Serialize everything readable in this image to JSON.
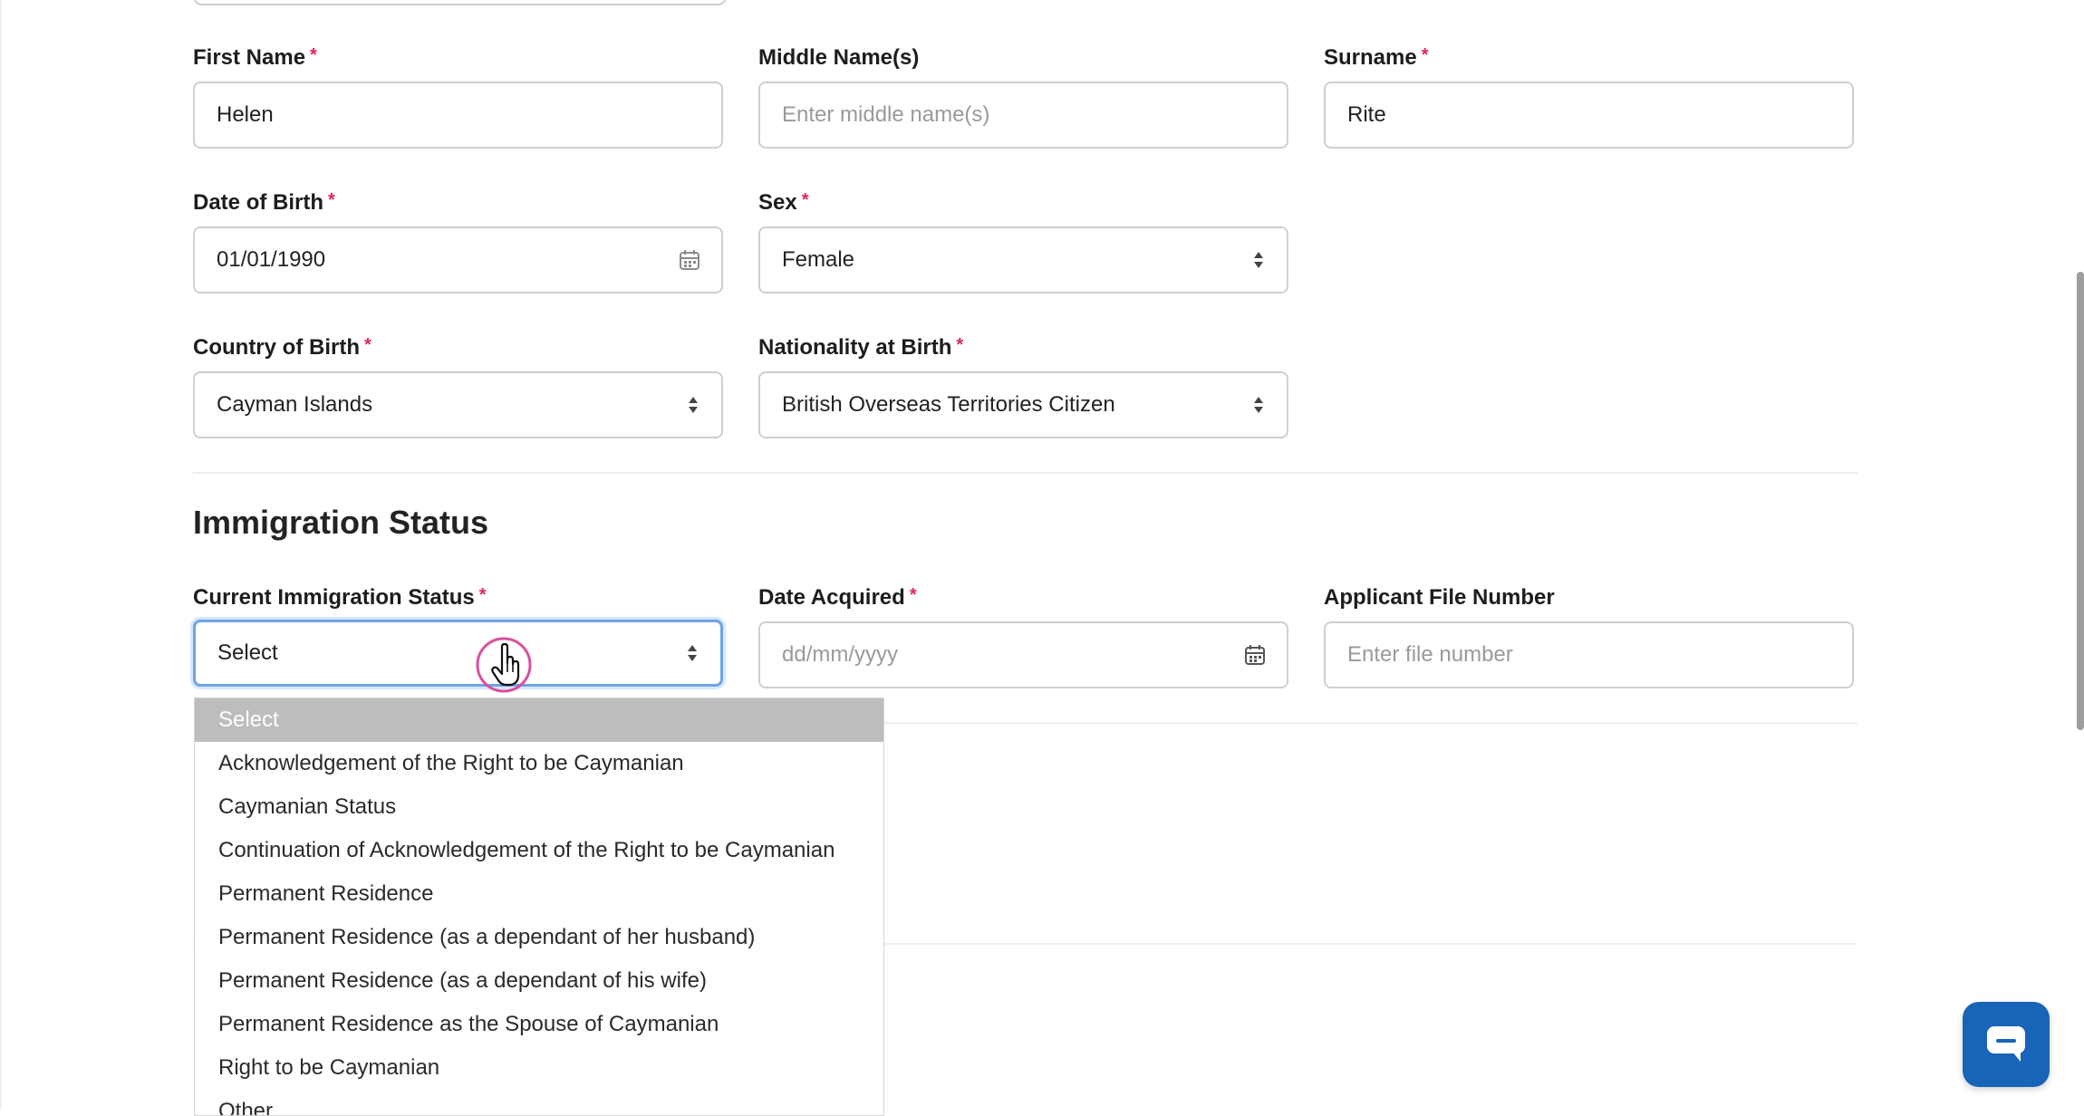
{
  "personal": {
    "first_name": {
      "label": "First Name",
      "value": "Helen",
      "required": "*"
    },
    "middle_name": {
      "label": "Middle Name(s)",
      "placeholder": "Enter middle name(s)"
    },
    "surname": {
      "label": "Surname",
      "value": "Rite",
      "required": "*"
    },
    "dob": {
      "label": "Date of Birth",
      "value": "01/01/1990",
      "required": "*"
    },
    "sex": {
      "label": "Sex",
      "value": "Female",
      "required": "*"
    },
    "country_of_birth": {
      "label": "Country of Birth",
      "value": "Cayman Islands",
      "required": "*"
    },
    "nationality_at_birth": {
      "label": "Nationality at Birth",
      "value": "British Overseas Territories Citizen",
      "required": "*"
    }
  },
  "immigration": {
    "title": "Immigration Status",
    "current_status": {
      "label": "Current Immigration Status",
      "value": "Select",
      "required": "*",
      "options": [
        "Select",
        "Acknowledgement of the Right to be Caymanian",
        "Caymanian Status",
        "Continuation of Acknowledgement of the Right to be Caymanian",
        "Permanent Residence",
        "Permanent Residence (as a dependant of her husband)",
        "Permanent Residence (as a dependant of his wife)",
        "Permanent Residence as the Spouse of Caymanian",
        "Right to be Caymanian",
        "Other"
      ]
    },
    "date_acquired": {
      "label": "Date Acquired",
      "placeholder": "dd/mm/yyyy",
      "required": "*"
    },
    "file_number": {
      "label": "Applicant File Number",
      "placeholder": "Enter file number"
    }
  },
  "colors": {
    "accent": "#1764b8",
    "required": "#e0245e",
    "focus": "#6fa3e6",
    "cursor_ring": "#d94fa0"
  },
  "icons": {
    "select": "updown-arrows-icon",
    "date": "calendar-icon",
    "chat": "chat-bubble-icon",
    "cursor": "hand-pointer-icon"
  }
}
